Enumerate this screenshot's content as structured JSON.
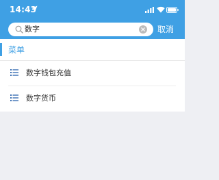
{
  "status_bar": {
    "time": "14:43",
    "icons": [
      "location-arrow-icon",
      "signal-icon",
      "wifi-icon",
      "battery-icon"
    ]
  },
  "search": {
    "value": "数字",
    "cancel_label": "取消"
  },
  "section": {
    "title": "菜单"
  },
  "menu": {
    "items": [
      {
        "label": "数字钱包充值",
        "icon": "list-icon"
      },
      {
        "label": "数字货币",
        "icon": "list-icon"
      }
    ]
  },
  "colors": {
    "accent": "#3fa0e4",
    "background": "#eeeff3"
  }
}
